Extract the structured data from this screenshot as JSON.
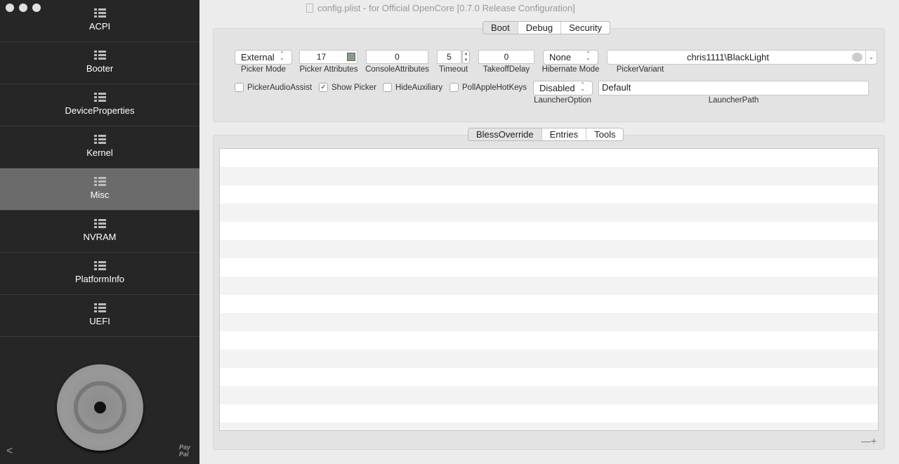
{
  "window": {
    "title": "config.plist - for Official OpenCore [0.7.0 Release Configuration]"
  },
  "sidebar": {
    "items": [
      {
        "label": "ACPI"
      },
      {
        "label": "Booter"
      },
      {
        "label": "DeviceProperties"
      },
      {
        "label": "Kernel"
      },
      {
        "label": "Misc",
        "active": true
      },
      {
        "label": "NVRAM"
      },
      {
        "label": "PlatformInfo"
      },
      {
        "label": "UEFI"
      }
    ],
    "paypal_line1": "Pay",
    "paypal_line2": "Pal"
  },
  "top_tabs": [
    "Boot",
    "Debug",
    "Security"
  ],
  "boot": {
    "picker_mode": {
      "value": "External",
      "label": "Picker Mode"
    },
    "picker_attributes": {
      "value": "17",
      "label": "Picker Attributes"
    },
    "console_attributes": {
      "value": "0",
      "label": "ConsoleAttributes"
    },
    "timeout": {
      "value": "5",
      "label": "Timeout"
    },
    "takeoff_delay": {
      "value": "0",
      "label": "TakeoffDelay"
    },
    "hibernate_mode": {
      "value": "None",
      "label": "Hibernate Mode"
    },
    "picker_variant": {
      "value": "chris1111\\BlackLight",
      "label": "PickerVariant"
    },
    "checkboxes": [
      {
        "label": "PickerAudioAssist",
        "checked": false
      },
      {
        "label": "Show Picker",
        "checked": true
      },
      {
        "label": "HideAuxiliary",
        "checked": false
      },
      {
        "label": "PollAppleHotKeys",
        "checked": false
      }
    ],
    "launcher_option": {
      "value": "Disabled",
      "label": "LauncherOption"
    },
    "launcher_path": {
      "value": "Default",
      "label": "LauncherPath"
    }
  },
  "bottom_tabs": [
    "BlessOverride",
    "Entries",
    "Tools"
  ],
  "check_mark": "✓",
  "footer": {
    "remove": "—",
    "add": "+"
  }
}
